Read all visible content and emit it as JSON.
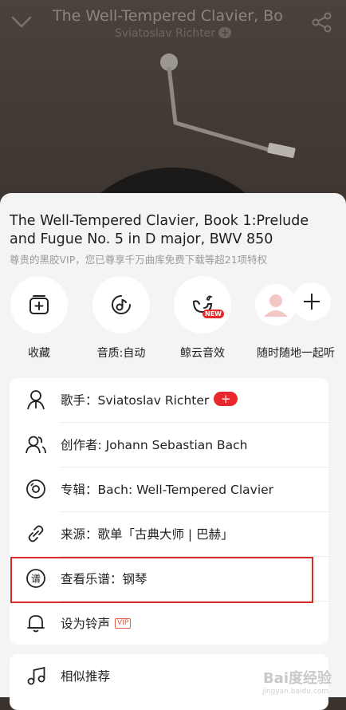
{
  "player": {
    "title": "The Well-Tempered Clavier, Bo",
    "artist": "Sviatoslav Richter",
    "artist_plus": "+"
  },
  "sheet": {
    "song_title": "The Well-Tempered Clavier, Book 1:Prelude and Fugue No. 5 in D major, BWV 850",
    "vip_hint": "尊贵的黑胶VIP，您已尊享千万曲库免费下载等超21项特权",
    "quick_actions": [
      {
        "label": "收藏",
        "icon": "collect-icon"
      },
      {
        "label": "音质:自动",
        "icon": "sound-quality-icon"
      },
      {
        "label": "鲸云音效",
        "icon": "whale-effect-icon",
        "badge": "NEW"
      },
      {
        "label": "随时随地一起听",
        "icon": "listen-together-icon"
      }
    ],
    "rows": [
      {
        "label": "歌手：Sviatoslav Richter",
        "badge": "+",
        "icon": "singer-icon"
      },
      {
        "label": "创作者: Johann Sebastian Bach",
        "icon": "composer-icon"
      },
      {
        "label": "专辑：Bach: Well-Tempered Clavier",
        "icon": "album-icon"
      },
      {
        "label": "来源：歌单「古典大师 | 巴赫」",
        "icon": "link-icon"
      },
      {
        "label": "查看乐谱：钢琴",
        "icon": "score-icon"
      },
      {
        "label": "设为铃声",
        "tag": "VIP",
        "icon": "bell-icon"
      }
    ],
    "similar": {
      "label": "相似推荐",
      "icon": "music-note-icon"
    }
  },
  "watermark": {
    "text": "Bai度经验",
    "sub": "jingyan.baidu.com"
  }
}
